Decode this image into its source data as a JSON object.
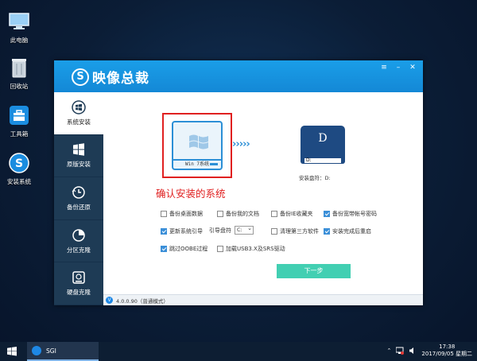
{
  "desktop": {
    "icons": [
      {
        "label": "此电脑"
      },
      {
        "label": "回收站"
      },
      {
        "label": "工具箱"
      },
      {
        "label": "安装系统"
      }
    ]
  },
  "window": {
    "brand_logo": "S",
    "brand": "映像总裁",
    "controls": [
      "≡",
      "–",
      "✕"
    ]
  },
  "sidebar": {
    "items": [
      {
        "label": "系统安装",
        "icon": "win-install-icon",
        "active": true
      },
      {
        "label": "原版安装",
        "icon": "windows-logo-icon"
      },
      {
        "label": "备份还原",
        "icon": "restore-clock-icon"
      },
      {
        "label": "分区克隆",
        "icon": "pie-chart-icon"
      },
      {
        "label": "硬盘克隆",
        "icon": "disk-clone-icon"
      }
    ]
  },
  "illustration": {
    "source_label": "Win 7系统",
    "arrows": "›››››",
    "target_letter": "D",
    "target_bar": "D:",
    "target_label": "安装盘符：D:"
  },
  "confirm_text": "确认安装的系统",
  "options": {
    "backup_desktop": {
      "label": "备份桌面数据",
      "checked": false
    },
    "backup_docs": {
      "label": "备份我的文档",
      "checked": false
    },
    "backup_ie": {
      "label": "备份IE收藏夹",
      "checked": false
    },
    "backup_broadband": {
      "label": "备份宽带帐号密码",
      "checked": true
    },
    "update_boot": {
      "label": "更新系统引导",
      "checked": true
    },
    "boot_drive_label": "引导盘符",
    "boot_drive_value": "C:",
    "clean_third": {
      "label": "清理第三方软件",
      "checked": false
    },
    "reboot_after": {
      "label": "安装完成后重启",
      "checked": true
    },
    "skip_oobe": {
      "label": "跳过OOBE过程",
      "checked": true
    },
    "load_usb": {
      "label": "加载USB3.X及SRS驱动",
      "checked": false
    }
  },
  "next_button": "下一步",
  "status": {
    "version": "4.0.0.90（普通模式）"
  },
  "taskbar": {
    "app": "SGI",
    "time": "17:38",
    "date": "2017/09/05 星期二"
  }
}
